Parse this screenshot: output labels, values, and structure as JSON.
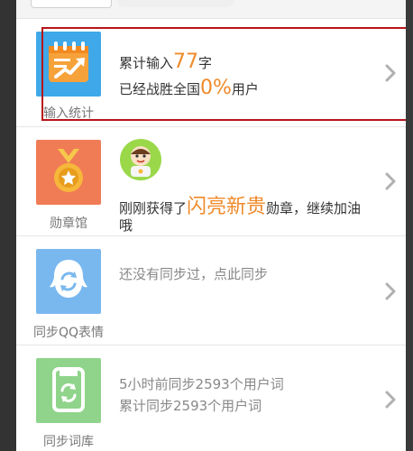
{
  "input_stats": {
    "label": "输入统计",
    "line1_prefix": "累计输入",
    "line1_number": "77",
    "line1_suffix": "字",
    "line2_prefix": "已经战胜全国",
    "line2_number": "0%",
    "line2_suffix": "用户"
  },
  "medal_hall": {
    "label": "勋章馆",
    "line1_prefix": "刚刚获得了",
    "line1_highlight": "闪亮新贵",
    "line1_suffix": "勋章，继续加油",
    "line2": "哦"
  },
  "sync_qq": {
    "label": "同步QQ表情",
    "text": "还没有同步过，点此同步"
  },
  "sync_dict": {
    "label": "同步词库",
    "line1": "5小时前同步2593个用户词",
    "line2": "累计同步2593个用户词"
  },
  "colors": {
    "accent_orange": "#f08a2a",
    "highlight_red": "#b8141a",
    "input_icon_bg": "#3fa8e8",
    "medal_icon_bg": "#f07c55",
    "qq_icon_bg": "#79b8ef",
    "dict_icon_bg": "#8fd48a"
  }
}
